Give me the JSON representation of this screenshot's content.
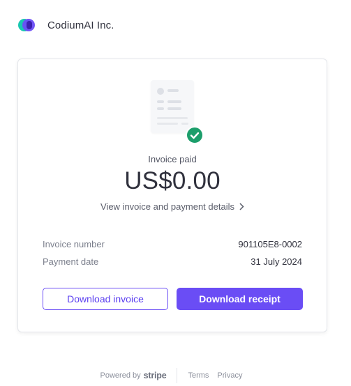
{
  "header": {
    "brand_name": "CodiumAI Inc."
  },
  "invoice": {
    "status": "Invoice paid",
    "amount": "US$0.00",
    "details_link": "View invoice and payment details",
    "rows": [
      {
        "label": "Invoice number",
        "value": "901105E8-0002"
      },
      {
        "label": "Payment date",
        "value": "31 July 2024"
      }
    ]
  },
  "actions": {
    "download_invoice": "Download invoice",
    "download_receipt": "Download receipt"
  },
  "footer": {
    "powered_by": "Powered by",
    "stripe": "stripe",
    "terms": "Terms",
    "privacy": "Privacy"
  },
  "colors": {
    "accent": "#6a4df5",
    "success": "#1c9e6b",
    "brand_teal": "#19c7b0"
  },
  "icons": [
    "codium-logo",
    "invoice-document-icon",
    "check-circle-icon",
    "chevron-right-icon"
  ]
}
